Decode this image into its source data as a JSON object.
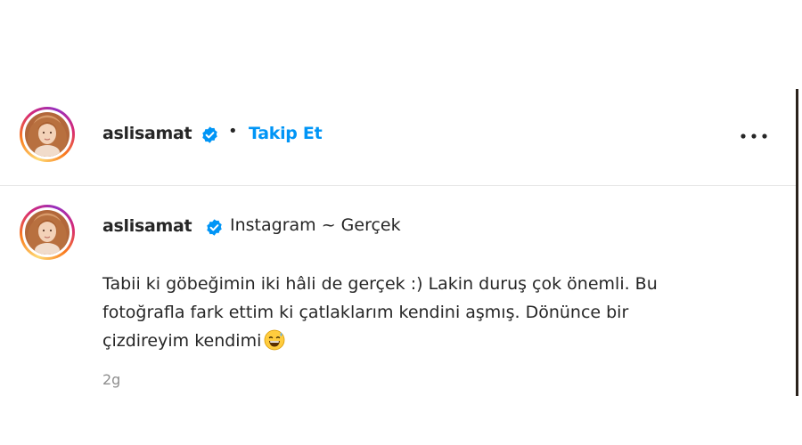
{
  "header": {
    "username": "aslisamat",
    "separator": "•",
    "follow_label": "Takip Et",
    "more_icon": "more-horizontal-icon"
  },
  "comment": {
    "username": "aslisamat",
    "title": "Instagram ~ Gerçek",
    "lines": [
      "Tabii ki göbeğimin iki hâli de gerçek :) Lakin duruş çok önemli. Bu",
      "fotoğrafla fark ettim ki çatlaklarım kendini aşmış. Dönünce bir",
      "çizdireyim kendimi"
    ],
    "emoji": "grinning-sweat-emoji",
    "timestamp": "2g"
  },
  "colors": {
    "follow": "#0095f6",
    "verified": "#0095f6",
    "text": "#262626",
    "muted": "#8e8e8e",
    "divider": "#e6e6e6"
  }
}
